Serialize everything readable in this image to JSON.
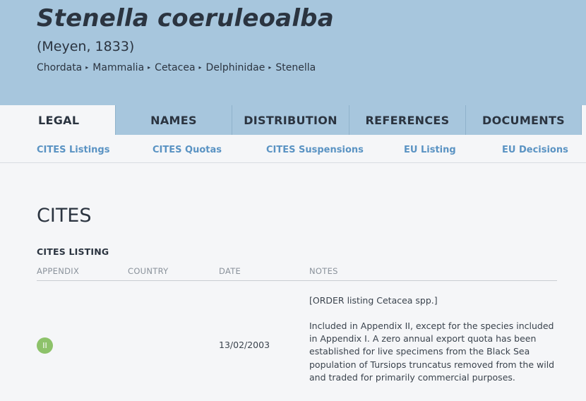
{
  "species": {
    "name": "Stenella coeruleoalba",
    "author": "(Meyen, 1833)",
    "taxonomy": [
      "Chordata",
      "Mammalia",
      "Cetacea",
      "Delphinidae",
      "Stenella"
    ],
    "separator": "▸"
  },
  "tabs": [
    "LEGAL",
    "NAMES",
    "DISTRIBUTION",
    "REFERENCES",
    "DOCUMENTS"
  ],
  "active_tab": "LEGAL",
  "subnav": [
    "CITES Listings",
    "CITES Quotas",
    "CITES Suspensions",
    "EU Listing",
    "EU Decisions"
  ],
  "section": {
    "title": "CITES",
    "subtitle": "CITES LISTING",
    "columns": [
      "APPENDIX",
      "COUNTRY",
      "DATE",
      "NOTES"
    ],
    "rows": [
      {
        "appendix": "II",
        "country": "",
        "date": "13/02/2003",
        "notes_order": "[ORDER listing Cetacea spp.]",
        "notes": "Included in Appendix II, except for the species included in Appendix I. A zero annual export quota has been established for live specimens from the Black Sea population of Tursiops truncatus removed from the wild and traded for primarily commercial purposes."
      }
    ]
  },
  "colors": {
    "header_bg": "#a7c6dd",
    "page_bg": "#f5f6f8",
    "link": "#5a93c3",
    "appendix_badge": "#8dc26a",
    "text_dark": "#2b3440"
  }
}
